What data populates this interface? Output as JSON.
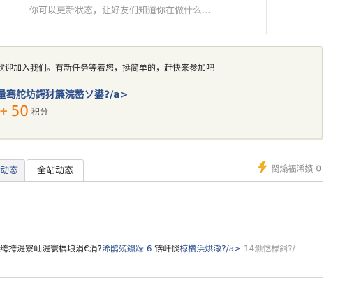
{
  "status": {
    "placeholder": "你可以更新状态，让好友们知道你在做什么..."
  },
  "task": {
    "welcome": "欢迎加入我们。有新任务等着您，挺简单的，赶快来参加吧",
    "link_text": "量骞舵坊鍔犲簾浣嶅ソ鍙?/a>",
    "reward_plus": "+",
    "reward_value": "50",
    "reward_unit": "积分"
  },
  "tabs": [
    {
      "label": "动态"
    },
    {
      "label": "全站动态"
    }
  ],
  "feed_count": "閫熻福浠嬪 0",
  "colors": {
    "accent": "#f06e00",
    "link": "#2b4d8c",
    "panel": "#f6f6ee"
  },
  "feed": {
    "lead": "绔挎湜寮屾湜寰楀埌涓€涓?",
    "user": "浠鹃殑鐤跺 6",
    "mid": " 锛屽惔",
    "link": "椋欑浜烘潵?/a>",
    "time": " 14灏忔椂鍓?/"
  }
}
